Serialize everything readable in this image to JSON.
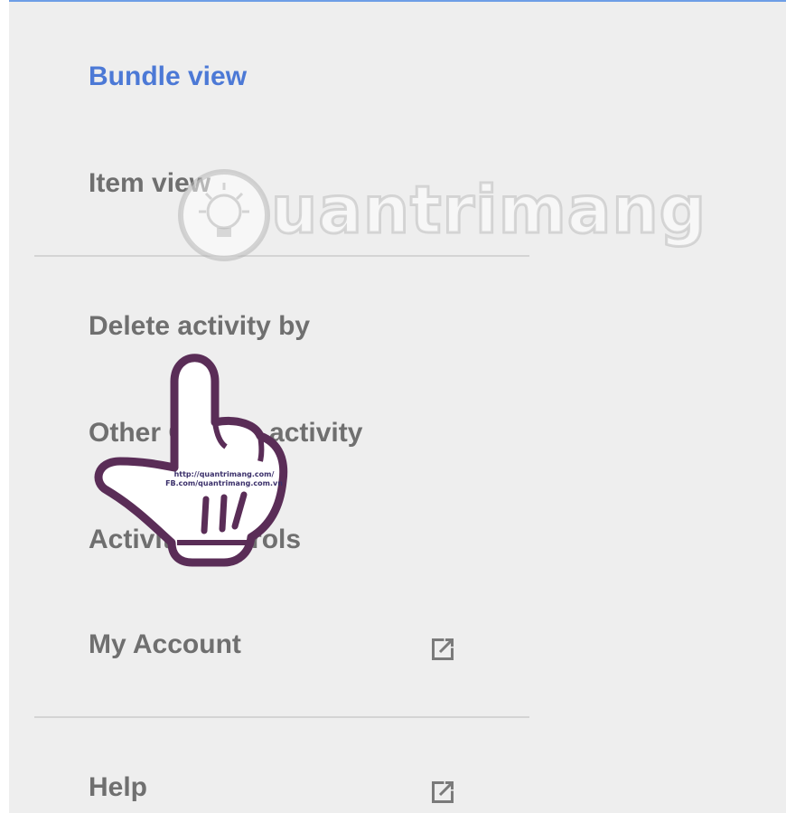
{
  "menu": {
    "bundle_view": "Bundle view",
    "item_view": "Item view",
    "delete_activity": "Delete activity by",
    "other_activity": "Other Google activity",
    "activity_controls": "Activity controls",
    "my_account": "My Account",
    "help": "Help"
  },
  "watermark": {
    "text": "uantrimang",
    "url_line1": "http://quantrimang.com/",
    "url_line2": "FB.com/quantrimang.com.vn"
  },
  "icons": {
    "external_link": "external-link-icon",
    "pointer": "pointing-hand-cursor"
  },
  "colors": {
    "active": "#4c79d6",
    "text": "#6f6f6f",
    "background": "#eeeeee",
    "top_border": "#6e9ee6",
    "cursor_outline": "#5a2d57"
  }
}
